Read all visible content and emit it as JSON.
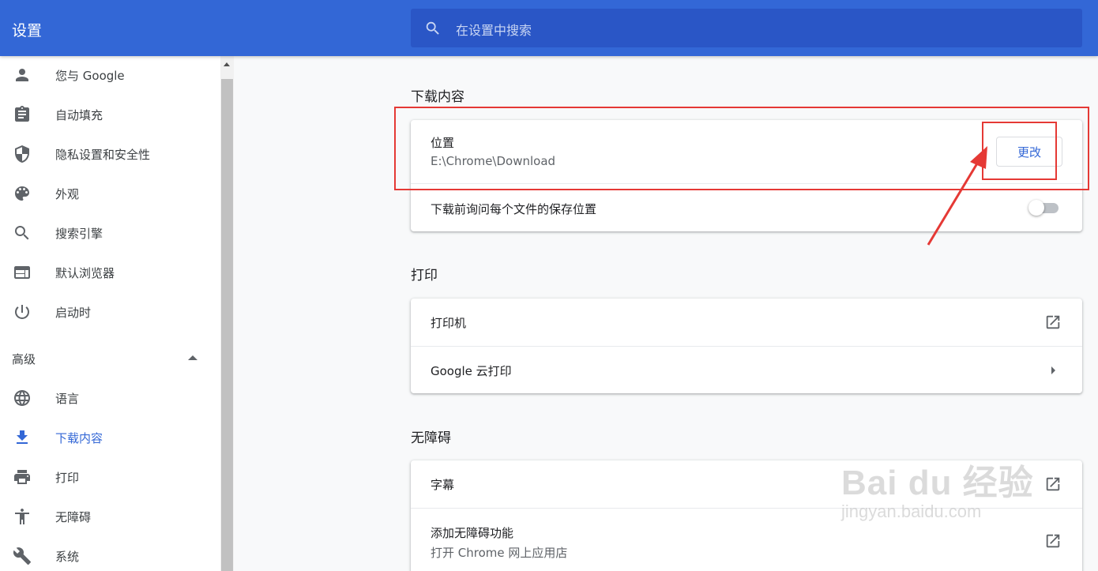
{
  "header": {
    "title": "设置",
    "search_placeholder": "在设置中搜索"
  },
  "sidebar": {
    "items": [
      {
        "label": "您与 Google",
        "icon": "person-icon"
      },
      {
        "label": "自动填充",
        "icon": "clipboard-icon"
      },
      {
        "label": "隐私设置和安全性",
        "icon": "shield-icon"
      },
      {
        "label": "外观",
        "icon": "palette-icon"
      },
      {
        "label": "搜索引擎",
        "icon": "search-icon"
      },
      {
        "label": "默认浏览器",
        "icon": "browser-icon"
      },
      {
        "label": "启动时",
        "icon": "power-icon"
      }
    ],
    "advanced_label": "高级",
    "advanced_items": [
      {
        "label": "语言",
        "icon": "globe-icon"
      },
      {
        "label": "下载内容",
        "icon": "download-icon",
        "active": true
      },
      {
        "label": "打印",
        "icon": "printer-icon"
      },
      {
        "label": "无障碍",
        "icon": "accessibility-icon"
      },
      {
        "label": "系统",
        "icon": "wrench-icon"
      }
    ]
  },
  "downloads": {
    "title": "下载内容",
    "location_label": "位置",
    "location_value": "E:\\Chrome\\Download",
    "change_button": "更改",
    "ask_label": "下载前询问每个文件的保存位置",
    "ask_enabled": false
  },
  "printing": {
    "title": "打印",
    "printers_label": "打印机",
    "cloud_print_label": "Google 云打印"
  },
  "accessibility": {
    "title": "无障碍",
    "captions_label": "字幕",
    "add_features_label": "添加无障碍功能",
    "add_features_sub": "打开 Chrome 网上应用店"
  },
  "watermark": {
    "main": "Bai du 经验",
    "sub": "jingyan.baidu.com"
  },
  "colors": {
    "header_bg": "#3367d6",
    "search_bg": "#2a56c6",
    "accent": "#3367d6",
    "annotation_red": "#e53935"
  }
}
